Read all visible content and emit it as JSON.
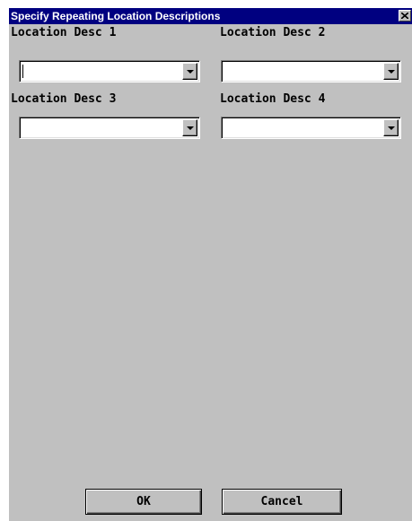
{
  "dialog": {
    "title": "Specify Repeating Location Descriptions",
    "close_icon": "close-x-icon"
  },
  "fields": [
    {
      "label": "Location Desc 1",
      "value": "",
      "focused": true
    },
    {
      "label": "Location Desc 2",
      "value": "",
      "focused": false
    },
    {
      "label": "Location Desc 3",
      "value": "",
      "focused": false
    },
    {
      "label": "Location Desc 4",
      "value": "",
      "focused": false
    }
  ],
  "buttons": {
    "ok_label": "OK",
    "cancel_label": "Cancel"
  },
  "colors": {
    "titlebar": "#000080",
    "dialog_face": "#c0c0c0",
    "field_background": "#ffffff"
  }
}
